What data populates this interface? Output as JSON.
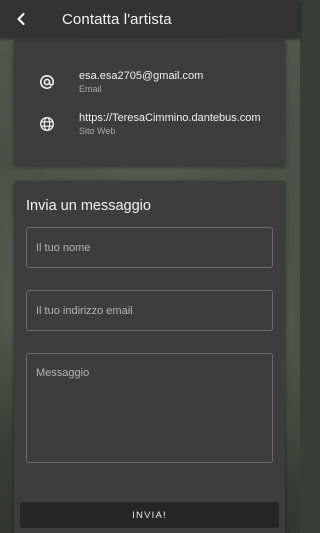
{
  "appbar": {
    "title": "Contatta l'artista",
    "back_icon": "back-arrow-icon"
  },
  "contacts": [
    {
      "icon": "at-sign-icon",
      "value": "esa.esa2705@gmail.com",
      "label": "Email"
    },
    {
      "icon": "globe-icon",
      "value": "https://TeresaCimmino.dantebus.com",
      "label": "Sito Web"
    }
  ],
  "form": {
    "title": "Invia un messaggio",
    "name_placeholder": "Il tuo nome",
    "email_placeholder": "Il tuo indirizzo email",
    "message_placeholder": "Messaggio",
    "send_label": "INVIA!"
  },
  "colors": {
    "appbar_bg": "#333333",
    "card_bg": "#3d3d3d",
    "button_bg": "#262626",
    "text_primary": "#f0f0f0",
    "text_secondary": "#a9a9a9"
  }
}
